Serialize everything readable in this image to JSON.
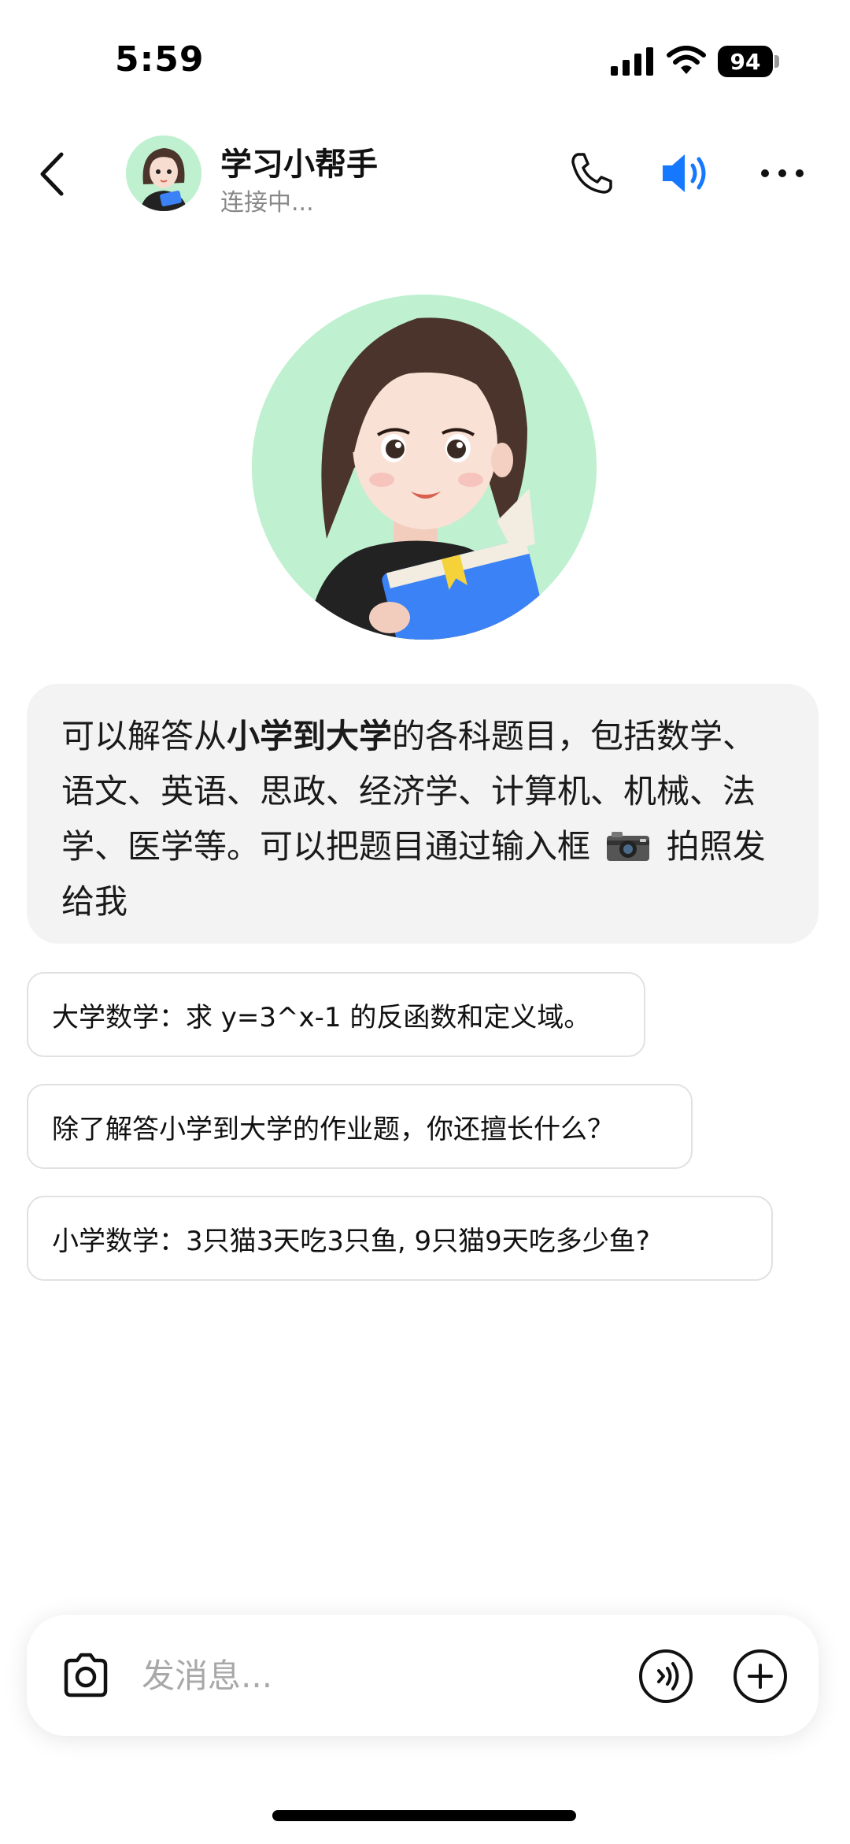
{
  "status_bar": {
    "time": "5:59",
    "battery": "94"
  },
  "header": {
    "title": "学习小帮手",
    "subtitle": "连接中..."
  },
  "intro": {
    "part1": "可以解答从",
    "bold": "小学到大学",
    "part2": "的各科题目，包括数学、语文、英语、思政、经济学、计算机、机械、法学、医学等。可以把题目通过输入框",
    "part3": "拍照发给我"
  },
  "suggestions": [
    {
      "text": "大学数学：求 y=3^x-1 的反函数和定义域。"
    },
    {
      "text": "除了解答小学到大学的作业题，你还擅长什么？"
    },
    {
      "text": "小学数学：3只猫3天吃3只鱼, 9只猫9天吃多少鱼?"
    }
  ],
  "input": {
    "placeholder": "发消息..."
  },
  "colors": {
    "accent": "#1677ff",
    "avatar_bg": "#bff0cf",
    "bubble_bg": "#f3f3f3"
  },
  "icons": [
    "back-icon",
    "phone-icon",
    "speaker-icon",
    "more-icon",
    "camera-icon",
    "voice-icon",
    "plus-icon"
  ]
}
